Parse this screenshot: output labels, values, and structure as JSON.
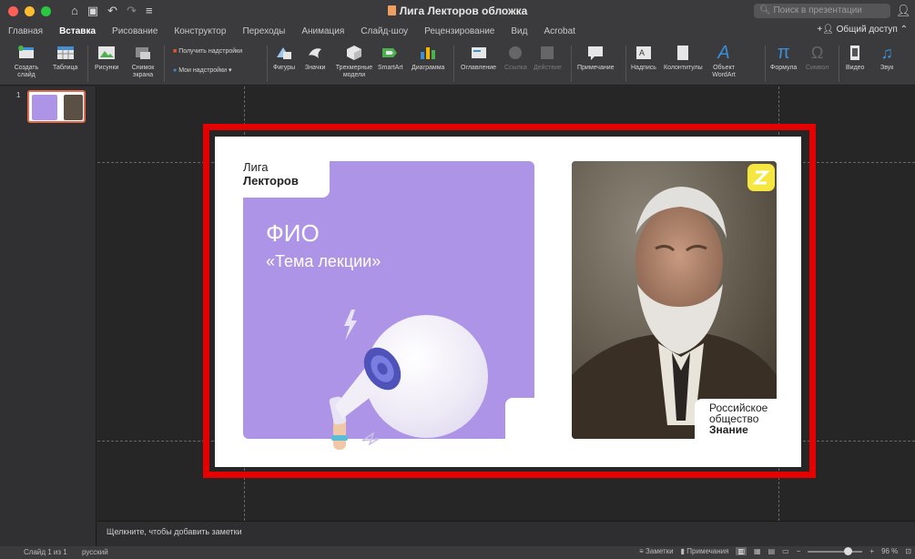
{
  "window": {
    "title": "Лига Лекторов обложка",
    "search_placeholder": "Поиск в презентации",
    "share": "Общий доступ"
  },
  "tabs": [
    "Главная",
    "Вставка",
    "Рисование",
    "Конструктор",
    "Переходы",
    "Анимация",
    "Слайд-шоу",
    "Рецензирование",
    "Вид",
    "Acrobat"
  ],
  "active_tab": "Вставка",
  "ribbon": {
    "new_slide": "Создать слайд",
    "table": "Таблица",
    "pictures": "Рисунки",
    "screenshot": "Снимок экрана",
    "get_addins": "Получить надстройки",
    "my_addins": "Мои надстройки",
    "shapes": "Фигуры",
    "icons": "Значки",
    "models3d": "Трехмерные модели",
    "smartart": "SmartArt",
    "chart": "Диаграмма",
    "toc": "Оглавление",
    "link": "Ссылка",
    "action": "Действие",
    "comment": "Примечание",
    "textbox": "Надпись",
    "header_footer": "Колонтитулы",
    "wordart": "Объект WordArt",
    "equation": "Формула",
    "symbol": "Символ",
    "video": "Видео",
    "audio": "Звук"
  },
  "colors": {
    "accent": "#ad94e6",
    "frame": "#e60000",
    "logo_yellow": "#f5e640"
  },
  "slide": {
    "number": "1",
    "brand_line1": "Лига",
    "brand_line2": "Лекторов",
    "fio": "ФИО",
    "topic": "«Тема лекции»",
    "org_line1": "Российское",
    "org_line2": "общество",
    "org_line3": "Знание"
  },
  "notes_placeholder": "Щелкните, чтобы добавить заметки",
  "status": {
    "slide_info": "Слайд 1 из 1",
    "language": "русский",
    "notes": "Заметки",
    "comments": "Примечания",
    "zoom": "96 %"
  }
}
